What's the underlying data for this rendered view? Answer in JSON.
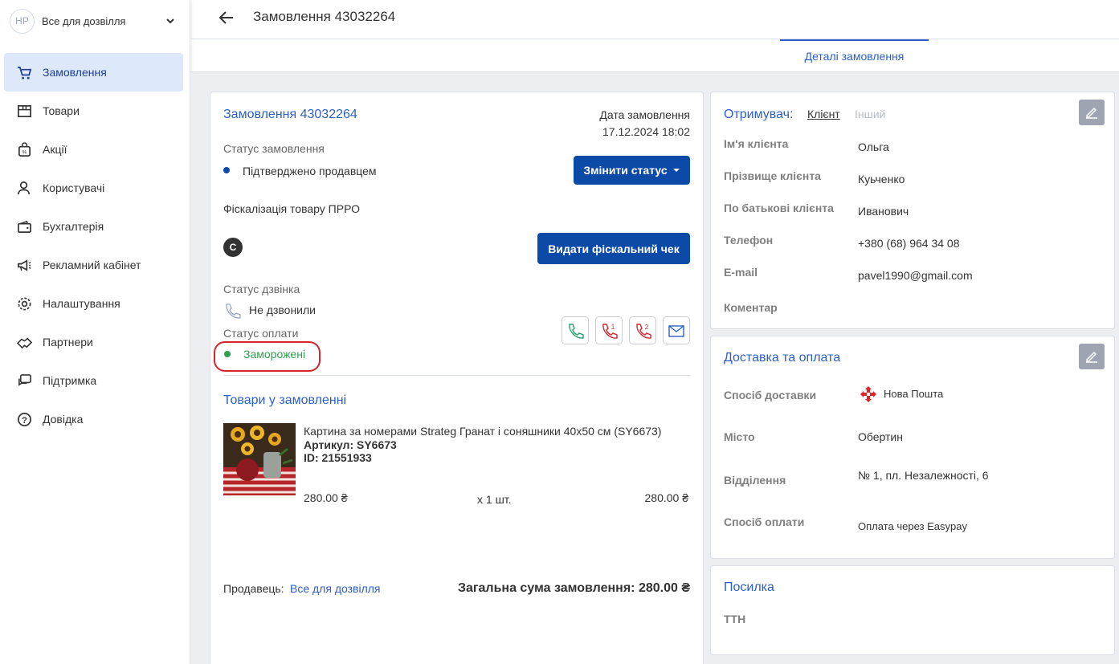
{
  "sidebar": {
    "avatar_initials": "HP",
    "shop_name": "Все для дозвілля",
    "items": [
      {
        "label": "Замовлення",
        "icon": "cart-icon",
        "active": true
      },
      {
        "label": "Товари",
        "icon": "box-icon"
      },
      {
        "label": "Акції",
        "icon": "shopping-bag-icon"
      },
      {
        "label": "Користувачі",
        "icon": "users-icon"
      },
      {
        "label": "Бухгалтерія",
        "icon": "wallet-icon"
      },
      {
        "label": "Рекламний кабінет",
        "icon": "megaphone-icon"
      },
      {
        "label": "Налаштування",
        "icon": "gear-icon"
      },
      {
        "label": "Партнери",
        "icon": "handshake-icon"
      },
      {
        "label": "Підтримка",
        "icon": "chat-icon"
      },
      {
        "label": "Довідка",
        "icon": "help-icon"
      }
    ]
  },
  "header": {
    "title": "Замовлення 43032264"
  },
  "tabs": {
    "active": "Деталі замовлення"
  },
  "order": {
    "title": "Замовлення 43032264",
    "date_label": "Дата замовлення",
    "date_value": "17.12.2024 18:02",
    "status_label": "Статус замовлення",
    "status_value": "Підтверджено продавцем",
    "change_status_button": "Змінити статус",
    "fiscal_label": "Фіскалізація товару ПРРО",
    "fiscal_badge": "C",
    "fiscal_button": "Видати фіскальний чек",
    "call_status_label": "Статус дзвінка",
    "call_status_value": "Не дзвонили",
    "payment_status_label": "Статус оплати",
    "payment_status_value": "Заморожені",
    "items_title": "Товари у замовленні",
    "product": {
      "name": "Картина за номерами Strateg Гранат і соняшники 40х50 см (SY6673)",
      "article": "Артикул: SY6673",
      "id": "ID: 21551933",
      "price": "280.00 ₴",
      "qty": "x 1 шт.",
      "total": "280.00 ₴"
    },
    "seller_label": "Продавець:",
    "seller_name": "Все для дозвілля",
    "total_label": "Загальна сума замовлення: 280.00 ₴"
  },
  "recipient": {
    "title": "Отримувач:",
    "tab_client": "Клієнт",
    "tab_other": "Інший",
    "fields": [
      {
        "label": "Ім'я клієнта",
        "value": "Ольга"
      },
      {
        "label": "Прізвище клієнта",
        "value": "Куьченко"
      },
      {
        "label": "По батькові клієнта",
        "value": "Иванович"
      },
      {
        "label": "Телефон",
        "value": "+380 (68) 964 34 08"
      },
      {
        "label": "E-mail",
        "value": "pavel1990@gmail.com"
      },
      {
        "label": "Коментар",
        "value": ""
      }
    ]
  },
  "delivery": {
    "title": "Доставка та оплата",
    "method_label": "Спосіб доставки",
    "method_value": "Нова Пошта",
    "city_label": "Місто",
    "city_value": "Обертин",
    "branch_label": "Відділення",
    "branch_value": "№ 1, пл. Незалежності, 6",
    "payment_label": "Спосіб оплати",
    "payment_value": "Оплата через Easypay"
  },
  "parcel": {
    "title": "Посилка",
    "ttn_label": "ТТН"
  },
  "colors": {
    "accent": "#2d5fc4",
    "button": "#0c4aa8",
    "status_paid": "#2e9e4f",
    "highlight": "#d6252f"
  }
}
